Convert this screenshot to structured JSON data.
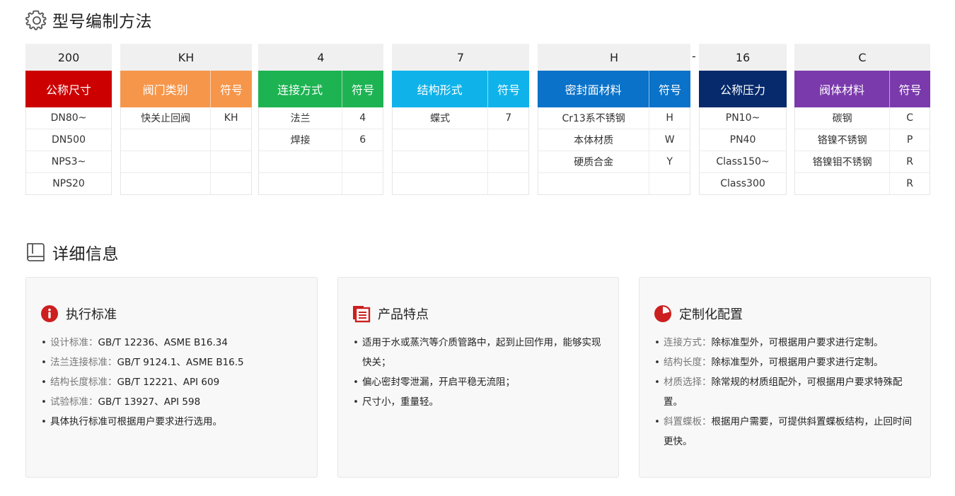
{
  "section1": {
    "title": "型号编制方法"
  },
  "section2": {
    "title": "详细信息"
  },
  "separator": "-",
  "code_table": {
    "size": {
      "code": "200",
      "header": "公称尺寸",
      "color": "#cc0000",
      "rows": [
        "DN80~",
        "DN500",
        "NPS3~",
        "NPS20"
      ]
    },
    "valve_type": {
      "code": "KH",
      "header": "阀门类别",
      "sym_header": "符号",
      "color": "#f6964a",
      "rows": [
        [
          "快关止回阀",
          "KH"
        ],
        [
          "",
          ""
        ],
        [
          "",
          ""
        ],
        [
          "",
          ""
        ]
      ]
    },
    "connection": {
      "code": "4",
      "header": "连接方式",
      "sym_header": "符号",
      "color": "#1db352",
      "rows": [
        [
          "法兰",
          "4"
        ],
        [
          "焊接",
          "6"
        ],
        [
          "",
          ""
        ],
        [
          "",
          ""
        ]
      ]
    },
    "structure": {
      "code": "7",
      "header": "结构形式",
      "sym_header": "符号",
      "color": "#0fb3ea",
      "rows": [
        [
          "蝶式",
          "7"
        ],
        [
          "",
          ""
        ],
        [
          "",
          ""
        ],
        [
          "",
          ""
        ]
      ]
    },
    "seal": {
      "code": "H",
      "header": "密封面材料",
      "sym_header": "符号",
      "color": "#0a72c8",
      "rows": [
        [
          "Cr13系不锈钢",
          "H"
        ],
        [
          "本体材质",
          "W"
        ],
        [
          "硬质合金",
          "Y"
        ],
        [
          "",
          ""
        ]
      ]
    },
    "pressure": {
      "code": "16",
      "header": "公称压力",
      "color": "#062a6b",
      "rows": [
        "PN10~",
        "PN40",
        "Class150~",
        "Class300"
      ]
    },
    "body": {
      "code": "C",
      "header": "阀体材料",
      "sym_header": "符号",
      "color": "#7a3aab",
      "rows": [
        [
          "碳钢",
          "C"
        ],
        [
          "铬镍不锈钢",
          "P"
        ],
        [
          "铬镍钼不锈钢",
          "R"
        ],
        [
          "",
          "R"
        ]
      ]
    }
  },
  "cards": {
    "standards": {
      "title": "执行标准",
      "icon": "info-icon",
      "icon_color": "#cc1f1f",
      "items": [
        {
          "k": "设计标准：",
          "v": "GB/T 12236、ASME B16.34"
        },
        {
          "k": "法兰连接标准：",
          "v": "GB/T 9124.1、ASME B16.5"
        },
        {
          "k": "结构长度标准：",
          "v": "GB/T 12221、API 609"
        },
        {
          "k": "试验标准：",
          "v": "GB/T 13927、API 598"
        },
        {
          "k": "",
          "v": "具体执行标准可根据用户要求进行选用。"
        }
      ]
    },
    "features": {
      "title": "产品特点",
      "icon": "document-icon",
      "icon_color": "#cc1f1f",
      "items": [
        "适用于水或蒸汽等介质管路中，起到止回作用，能够实现快关；",
        "偏心密封零泄漏，开启平稳无流阻；",
        "尺寸小，重量轻。"
      ]
    },
    "custom": {
      "title": "定制化配置",
      "icon": "pie-chart-icon",
      "icon_color": "#cc1f1f",
      "items": [
        {
          "k": "连接方式：",
          "v": "除标准型外，可根据用户要求进行定制。"
        },
        {
          "k": "结构长度：",
          "v": "除标准型外，可根据用户要求进行定制。"
        },
        {
          "k": "材质选择：",
          "v": "除常规的材质组配外，可根据用户要求特殊配置。"
        },
        {
          "k": "斜置蝶板：",
          "v": "根据用户需要，可提供斜置蝶板结构，止回时间更快。"
        }
      ]
    }
  }
}
